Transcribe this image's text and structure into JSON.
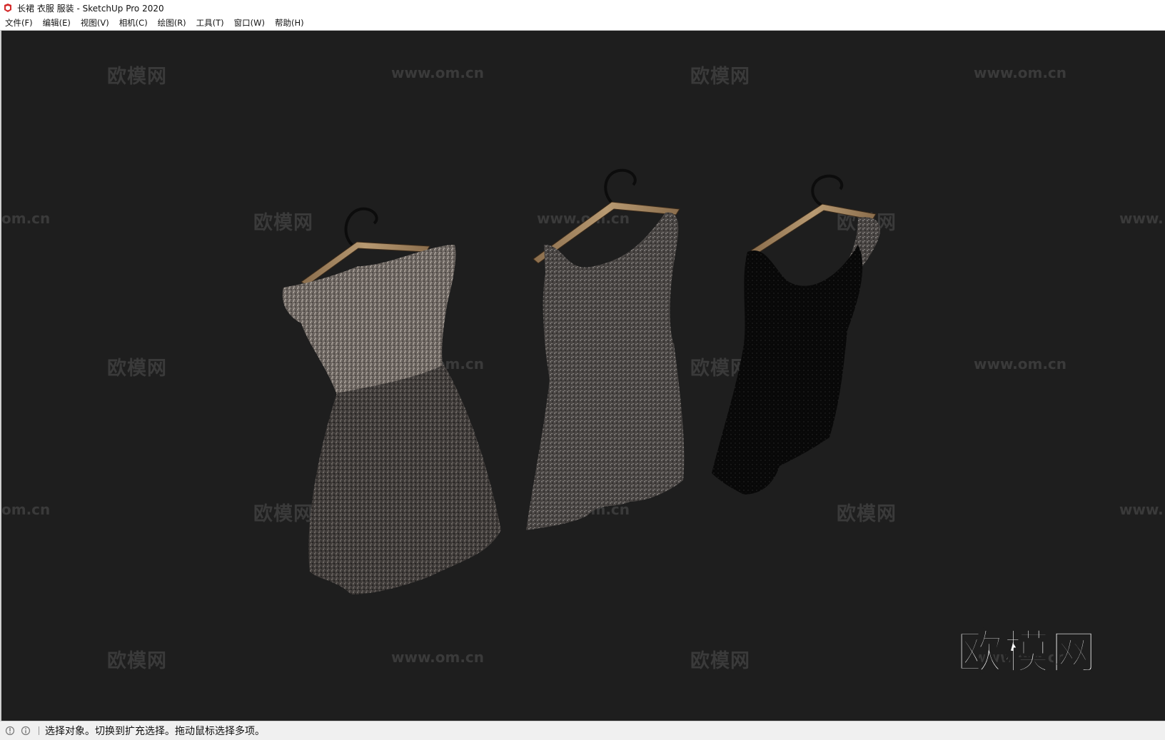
{
  "window": {
    "title": "长裙 衣服 服装 - SketchUp Pro 2020",
    "app_icon": "sketchup-logo-icon"
  },
  "menubar": {
    "items": [
      {
        "label": "文件(F)"
      },
      {
        "label": "编辑(E)"
      },
      {
        "label": "视图(V)"
      },
      {
        "label": "相机(C)"
      },
      {
        "label": "绘图(R)"
      },
      {
        "label": "工具(T)"
      },
      {
        "label": "窗口(W)"
      },
      {
        "label": "帮助(H)"
      }
    ]
  },
  "viewport": {
    "background": "#1e1e1e",
    "watermark_cn": "欧模网",
    "watermark_en": "www.om.cn",
    "watermark_en_short": "www.",
    "watermark_en_tail": "om.cn",
    "logo_text": "欧模网",
    "models": [
      "dress-left",
      "dress-middle",
      "dress-right"
    ]
  },
  "statusbar": {
    "icons": [
      "geo-location-icon",
      "info-icon"
    ],
    "message": "选择对象。切换到扩充选择。拖动鼠标选择多项。"
  }
}
